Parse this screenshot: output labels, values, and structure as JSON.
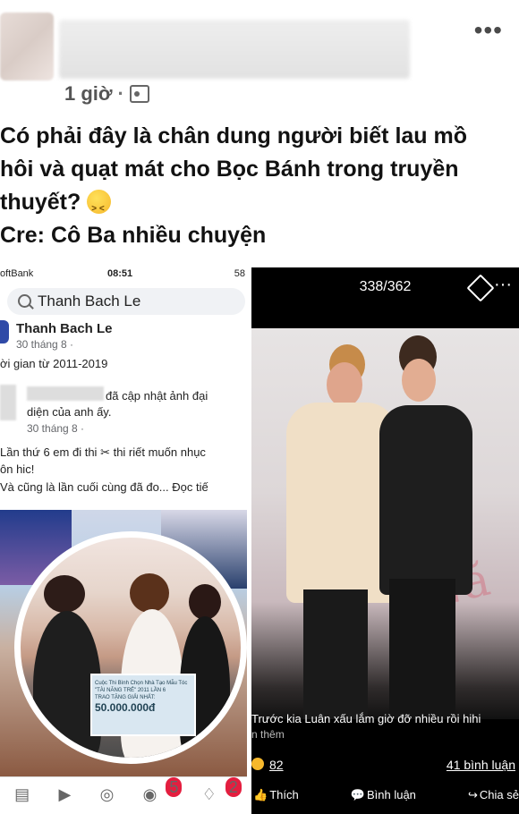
{
  "header": {
    "time": "1 giờ",
    "separator": "·",
    "more_label": "•••"
  },
  "post": {
    "line1": "Có phải đây là chân dung người biết lau mồ",
    "line2": "hôi và quạt mát cho Bọc Bánh trong truyền",
    "line3": "thuyết?",
    "line4": "Cre: Cô Ba nhiều chuyện"
  },
  "left_screen": {
    "status_left": "oftBank",
    "status_time": "08:51",
    "status_right": "58",
    "search_text": "Thanh Bach Le",
    "profile_name": "Thanh Bach Le",
    "profile_date": "30 tháng 8 ·",
    "period_text": "ời gian từ 2011-2019",
    "update_text_1": "đã cập nhật ảnh đại",
    "update_text_2": "diện của anh ấy.",
    "update_date": "30 tháng 8 ·",
    "caption_1": "Lần thứ 6 em đi thi",
    "caption_1b": "thi riết muốn nhục",
    "caption_2": "ôn hic!",
    "caption_3": "Và cũng là lần cuối cùng đã đo... Đọc tiế",
    "banner_line1": "Cuộc Thi Bình Chọn Nhà Tạo Mẫu Tóc",
    "banner_line2": "\"TÀI NĂNG TRẺ\" 2011 LẦN 6",
    "banner_line3": "TRAO TẶNG GIẢI NHẤT:",
    "banner_amount": "50.000.000đ",
    "nav_badge_friends": "5",
    "nav_badge_notifications": "2"
  },
  "right_screen": {
    "counter": "338/362",
    "more_label": "···",
    "caption": "Trước kia Luân xấu lắm giờ đỡ nhiều rồi hihi",
    "see_more": "n thêm",
    "reaction_count": "82",
    "comment_count": "41 bình luận",
    "action_like": "Thích",
    "action_comment": "Bình luận",
    "action_share": "Chia sẻ"
  }
}
